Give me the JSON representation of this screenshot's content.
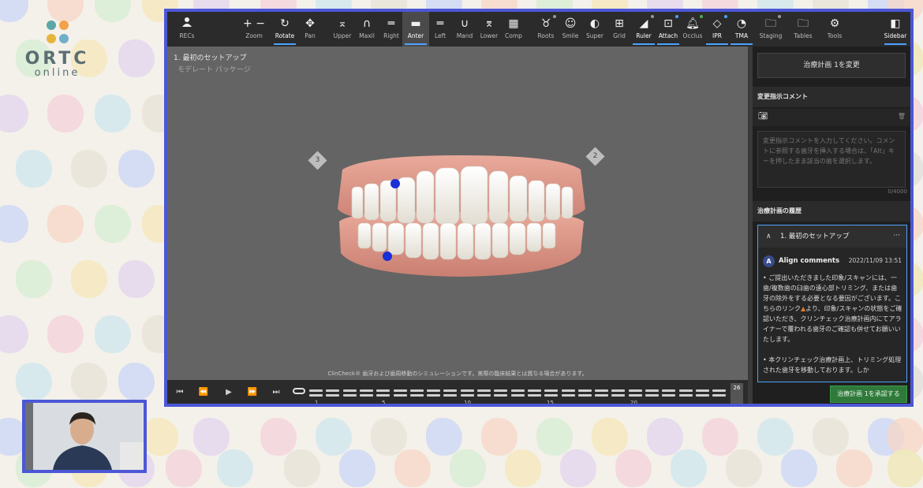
{
  "brand": {
    "name": "ORTC",
    "sub": "online",
    "colors": [
      "#5aa6a8",
      "#f2a24a",
      "#e7b53d",
      "#6fb0c8"
    ]
  },
  "toolbar": {
    "recs": "RECs",
    "zoom": "Zoom",
    "rotate": "Rotate",
    "pan": "Pan",
    "upper": "Upper",
    "maxil": "Maxil",
    "right": "Right",
    "anter": "Anter",
    "left": "Left",
    "mand": "Mand",
    "lower": "Lower",
    "comp": "Comp",
    "roots": "Roots",
    "smile": "Smile",
    "super": "Super",
    "grid": "Grid",
    "ruler": "Ruler",
    "attach": "Attach",
    "occlus": "Occlus",
    "ipr": "IPR",
    "tma": "TMA",
    "staging": "Staging",
    "tables": "Tables",
    "tools": "Tools",
    "sidebar": "Sidebar"
  },
  "viewport": {
    "title": "1. 最初のセットアップ",
    "subtitle": "モデレート パッケージ",
    "marker_left": "3",
    "marker_right": "2",
    "disclaimer": "ClinCheck® 歯牙および歯周移動のシミュレーションです。実際の臨床結果とは異なる場合があります。"
  },
  "timeline": {
    "ticks": [
      "1",
      "5",
      "10",
      "15",
      "20"
    ],
    "end_stage": "26"
  },
  "sidebar": {
    "change_button": "治療計画 1を変更",
    "comment_section": "変更指示コメント",
    "comment_placeholder": "変更指示コメントを入力してください。コメントに参照する歯牙を挿入する場合は、「Alt」キーを押したまま該当の歯を選択します。",
    "counter": "0/4000",
    "history_section": "治療計画の履歴",
    "history_title": "1. 最初のセットアップ",
    "comment_author_initial": "A",
    "comment_author": "Align comments",
    "comment_date": "2022/11/09 13:51",
    "comment_p1_a": "• ご提出いただきました印象/スキャンには、一歯/複数歯の臼歯の遠心部トリミング、または歯牙の除外をする必要となる要因がございます。こちらのリンク",
    "comment_p1_b": "より、印象/スキャンの状態をご確認いただき、クリンチェック治療計画内にてアライナーで覆われる歯牙のご確認も併せてお願いいたします。",
    "comment_p2": "• 本クリンチェック治療計画上、トリミング処理された歯牙を移動しております。しか",
    "approve_button": "治療計画 1を承認する"
  }
}
